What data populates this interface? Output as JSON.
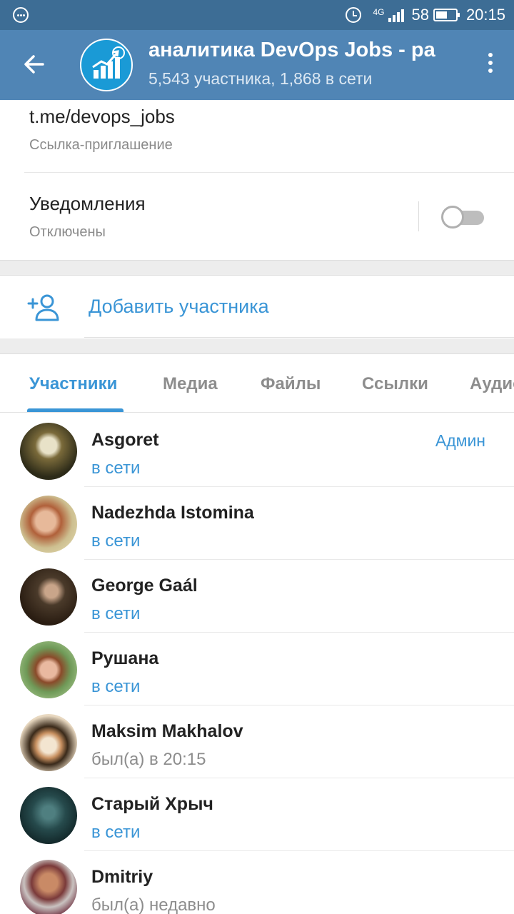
{
  "status_bar": {
    "network": "4G",
    "battery": "58",
    "battery_fraction": 0.58,
    "time": "20:15"
  },
  "header": {
    "title": "аналитика    DevOps Jobs - ра",
    "subtitle": "5,543 участника, 1,868 в сети"
  },
  "info": {
    "link": "t.me/devops_jobs",
    "link_caption": "Ссылка-приглашение",
    "notifications_label": "Уведомления",
    "notifications_value": "Отключены"
  },
  "add_member_label": "Добавить участника",
  "tabs": [
    {
      "label": "Участники"
    },
    {
      "label": "Медиа"
    },
    {
      "label": "Файлы"
    },
    {
      "label": "Ссылки"
    },
    {
      "label": "Аудио"
    }
  ],
  "members": [
    {
      "name": "Asgoret",
      "status": "в сети",
      "role": "Админ"
    },
    {
      "name": "Nadezhda Istomina",
      "status": "в сети",
      "role": ""
    },
    {
      "name": "George Gaál",
      "status": "в сети",
      "role": ""
    },
    {
      "name": "Рушана",
      "status": "в сети",
      "role": ""
    },
    {
      "name": "Maksim Makhalov",
      "status": "был(а) в 20:15",
      "role": ""
    },
    {
      "name": "Старый Хрыч",
      "status": "в сети",
      "role": ""
    },
    {
      "name": "Dmitriy",
      "status": "был(а) недавно",
      "role": ""
    }
  ],
  "colors": {
    "header": "#5085b5",
    "status_bar": "#3d6d95",
    "accent": "#3a95d6"
  }
}
